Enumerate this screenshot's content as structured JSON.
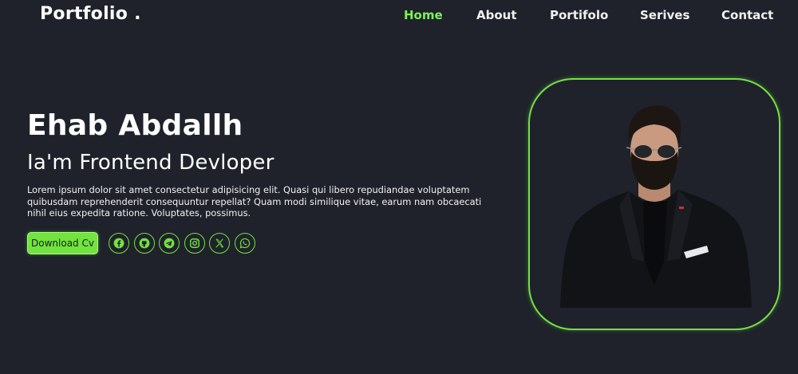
{
  "header": {
    "logo": "Portfolio .",
    "nav": [
      {
        "label": "Home",
        "active": true
      },
      {
        "label": "About",
        "active": false
      },
      {
        "label": "Portifolo",
        "active": false
      },
      {
        "label": "Serives",
        "active": false
      },
      {
        "label": "Contact",
        "active": false
      }
    ]
  },
  "hero": {
    "name": "Ehab Abdallh",
    "role": "Ia'm Frontend Devloper",
    "description": "Lorem ipsum dolor sit amet consectetur adipisicing elit. Quasi qui libero repudiandae voluptatem quibusdam reprehenderit consequuntur repellat? Quam modi similique vitae, earum nam obcaecati nihil eius expedita ratione. Voluptates, possimus.",
    "cv_button": "Download Cv",
    "socials": [
      "facebook-icon",
      "github-icon",
      "telegram-icon",
      "instagram-icon",
      "x-icon",
      "whatsapp-icon"
    ]
  },
  "colors": {
    "background": "#1f222a",
    "accent": "#72e33f",
    "text": "#ffffff"
  }
}
